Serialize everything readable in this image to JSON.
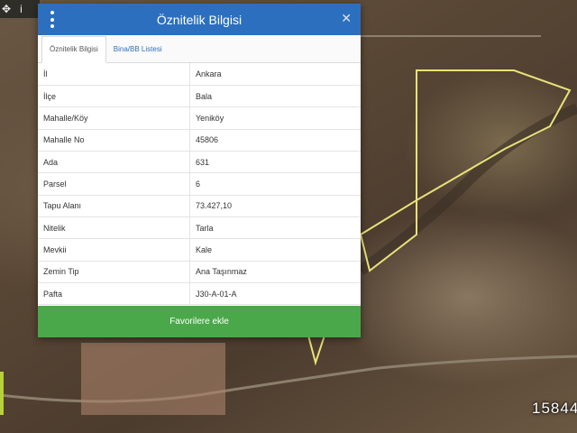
{
  "toolbar": {
    "tool1_glyph": "✥",
    "tool2_glyph": "i"
  },
  "panel": {
    "title": "Öznitelik Bilgisi",
    "close_glyph": "✕",
    "tabs": [
      {
        "label": "Öznitelik Bilgisi",
        "active": true
      },
      {
        "label": "Bina/BB Listesi",
        "active": false
      }
    ],
    "rows": [
      {
        "key": "İl",
        "value": "Ankara"
      },
      {
        "key": "İlçe",
        "value": "Bala"
      },
      {
        "key": "Mahalle/Köy",
        "value": "Yeniköy"
      },
      {
        "key": "Mahalle No",
        "value": "45806"
      },
      {
        "key": "Ada",
        "value": "631"
      },
      {
        "key": "Parsel",
        "value": "6"
      },
      {
        "key": "Tapu Alanı",
        "value": "73.427,10"
      },
      {
        "key": "Nitelik",
        "value": "Tarla"
      },
      {
        "key": "Mevkii",
        "value": "Kale"
      },
      {
        "key": "Zemin Tip",
        "value": "Ana Taşınmaz"
      },
      {
        "key": "Pafta",
        "value": "J30-A-01-A"
      }
    ],
    "favorite_button_label": "Favorilere ekle"
  },
  "map": {
    "parcel_label": "15844"
  },
  "colors": {
    "header_blue": "#2d6fbf",
    "button_green": "#4aa84a",
    "parcel_outline": "#e8e27a",
    "side_tab": "#b7d237"
  }
}
